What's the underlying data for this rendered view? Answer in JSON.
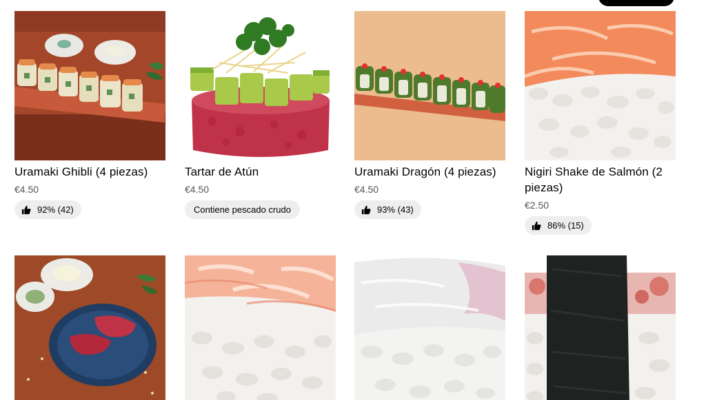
{
  "items": [
    {
      "name": "Uramaki Ghibli (4 piezas)",
      "price": "€4.50",
      "rating": "92% (42)",
      "image_icon": "uramaki-ghibli-photo"
    },
    {
      "name": "Tartar de Atún",
      "price": "€4.50",
      "tag": "Contiene pescado crudo",
      "image_icon": "tuna-tartare-photo"
    },
    {
      "name": "Uramaki Dragón (4 piezas)",
      "price": "€4.50",
      "rating": "93% (43)",
      "image_icon": "uramaki-dragon-photo"
    },
    {
      "name": "Nigiri Shake de Salmón (2 piezas)",
      "price": "€2.50",
      "rating": "86% (15)",
      "image_icon": "salmon-nigiri-photo"
    },
    {
      "image_icon": "tuna-tataki-photo"
    },
    {
      "image_icon": "shrimp-nigiri-photo"
    },
    {
      "image_icon": "white-fish-nigiri-photo"
    },
    {
      "image_icon": "octopus-nigiri-photo"
    }
  ],
  "icons": {
    "rating": "thumbs-up-icon"
  },
  "colors": {
    "chip_bg": "#eeeeee",
    "price_text": "#545454"
  }
}
